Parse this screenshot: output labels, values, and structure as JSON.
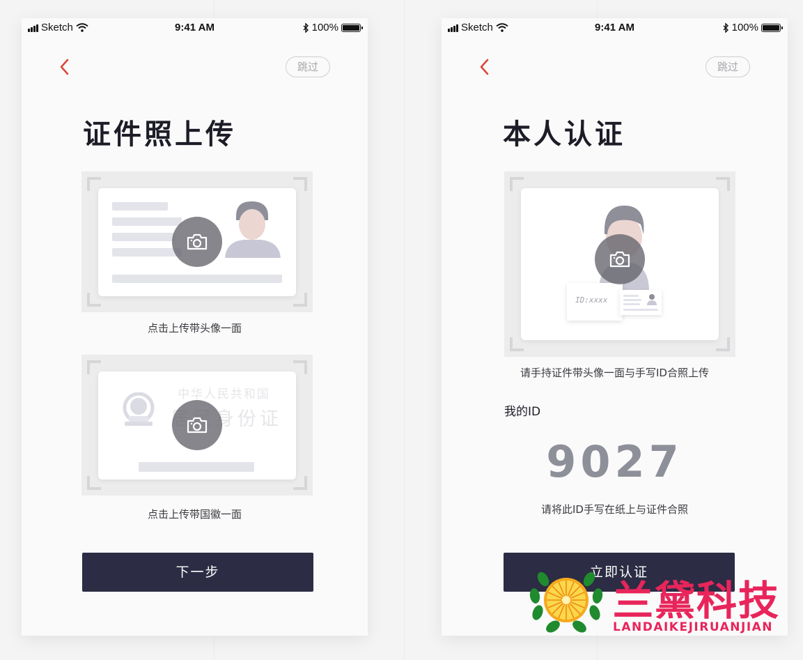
{
  "status_bar": {
    "carrier": "Sketch",
    "time": "9:41 AM",
    "battery": "100%"
  },
  "screen_upload": {
    "skip_label": "跳过",
    "title": "证件照上传",
    "front_caption": "点击上传带头像一面",
    "back_card_line1": "中华人民共和国",
    "back_card_line2": "居民身份证",
    "back_caption": "点击上传带国徽一面",
    "next_button": "下一步"
  },
  "screen_verify": {
    "skip_label": "跳过",
    "title": "本人认证",
    "id_card_text": "ID:xxxx",
    "instruction": "请手持证件带头像一面与手写ID合照上传",
    "my_id_label": "我的ID",
    "my_id_value": "9027",
    "hint": "请将此ID手写在纸上与证件合照",
    "verify_button": "立即认证"
  },
  "watermark": {
    "name_cn": "兰黛科技",
    "name_en": "LANDAIKEJIRUANJIAN"
  },
  "colors": {
    "accent_red": "#d9473b",
    "button_dark": "#2c2c44",
    "logo_pink": "#e8255b"
  }
}
